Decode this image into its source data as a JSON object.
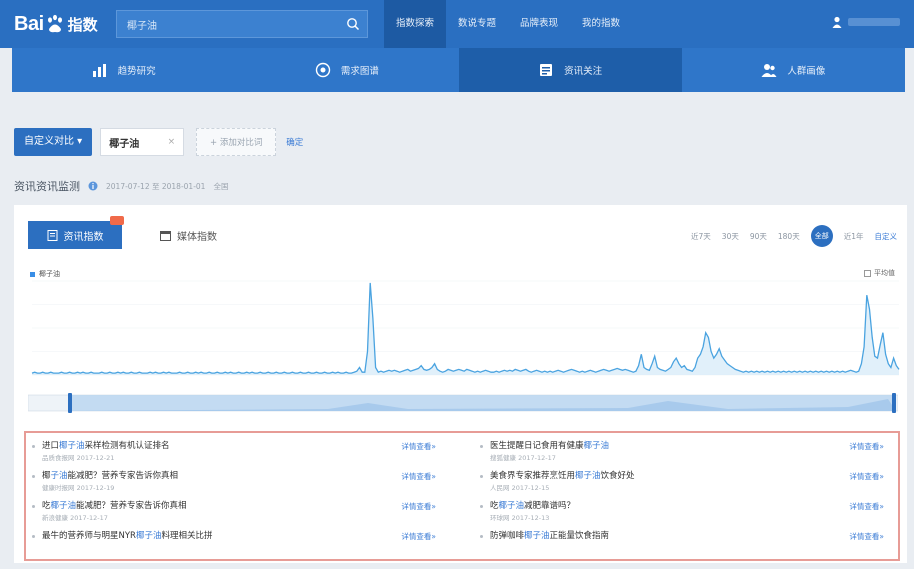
{
  "header": {
    "logo_brand": "Bai",
    "logo_suffix": "指数",
    "search_value": "椰子油",
    "nav": [
      "指数探索",
      "数说专题",
      "品牌表现",
      "我的指数"
    ],
    "active_nav": 0
  },
  "subnav": {
    "items": [
      "趋势研究",
      "需求图谱",
      "资讯关注",
      "人群画像"
    ],
    "icons": [
      "chart-bar-icon",
      "target-icon",
      "news-icon",
      "people-icon"
    ],
    "active": 2
  },
  "filter": {
    "type_button": "自定义对比",
    "keyword": "椰子油",
    "keyword_close": "×",
    "add_compare": "+ 添加对比词",
    "confirm": "确定"
  },
  "section": {
    "title": "资讯资讯监测",
    "meta": "2017-07-12 至 2018-01-01",
    "link": "全国"
  },
  "tabs": {
    "active_label": "资讯指数",
    "inactive_label": "媒体指数"
  },
  "ranges": [
    "近7天",
    "30天",
    "90天",
    "180天",
    "全部",
    "近1年",
    "自定义"
  ],
  "active_range": 4,
  "legend": {
    "series": "椰子油",
    "average": "平均值"
  },
  "chart_data": {
    "type": "area",
    "series": [
      {
        "name": "椰子油",
        "values": [
          2,
          3,
          2,
          2,
          3,
          2,
          2,
          3,
          2,
          2,
          2,
          3,
          2,
          2,
          3,
          2,
          2,
          3,
          2,
          3,
          2,
          2,
          3,
          2,
          2,
          2,
          3,
          2,
          2,
          3,
          2,
          2,
          3,
          2,
          3,
          2,
          2,
          3,
          2,
          2,
          3,
          2,
          2,
          2,
          3,
          2,
          3,
          2,
          2,
          3,
          2,
          3,
          2,
          2,
          2,
          3,
          2,
          2,
          3,
          2,
          2,
          3,
          2,
          3,
          2,
          2,
          3,
          2,
          2,
          3,
          2,
          2,
          3,
          2,
          3,
          2,
          2,
          3,
          2,
          2,
          3,
          2,
          3,
          2,
          2,
          3,
          2,
          2,
          3,
          2,
          2,
          3,
          2,
          2,
          3,
          2,
          2,
          3,
          2,
          2,
          3,
          2,
          2,
          3,
          2,
          2,
          3,
          2,
          2,
          3,
          2,
          2,
          3,
          2,
          3,
          2,
          2,
          3,
          2,
          2,
          3,
          4,
          8,
          3,
          3,
          25,
          98,
          60,
          8,
          3,
          4,
          3,
          4,
          5,
          4,
          5,
          4,
          3,
          4,
          5,
          6,
          4,
          5,
          6,
          7,
          10,
          6,
          5,
          6,
          8,
          12,
          6,
          4,
          3,
          4,
          6,
          5,
          4,
          5,
          6,
          5,
          4,
          6,
          5,
          4,
          3,
          4,
          3,
          4,
          5,
          4,
          3,
          3,
          4,
          3,
          4,
          5,
          4,
          5,
          4,
          6,
          5,
          4,
          5,
          6,
          4,
          3,
          4,
          5,
          4,
          3,
          4,
          3,
          4,
          3,
          4,
          5,
          4,
          3,
          4,
          5,
          6,
          5,
          4,
          3,
          4,
          3,
          4,
          5,
          4,
          3,
          4,
          5,
          6,
          5,
          4,
          5,
          6,
          7,
          6,
          5,
          6,
          5,
          4,
          3,
          4,
          10,
          22,
          8,
          6,
          5,
          12,
          20,
          8,
          6,
          5,
          4,
          6,
          8,
          14,
          18,
          12,
          8,
          10,
          6,
          5,
          4,
          8,
          18,
          22,
          30,
          45,
          40,
          25,
          18,
          22,
          28,
          20,
          16,
          12,
          10,
          8,
          6,
          5,
          4,
          3,
          4,
          3,
          4,
          3,
          4,
          3,
          4,
          3,
          4,
          3,
          4,
          3,
          4,
          3,
          4,
          3,
          4,
          3,
          4,
          3,
          4,
          3,
          4,
          3,
          4,
          3,
          4,
          3,
          4,
          3,
          4,
          3,
          4,
          3,
          4,
          3,
          4,
          3,
          4,
          5,
          4,
          3,
          4,
          12,
          30,
          85,
          70,
          40,
          20,
          18,
          32,
          45,
          22,
          12,
          8,
          18,
          10,
          6
        ]
      }
    ],
    "ylim": [
      0,
      100
    ],
    "xlabel": "",
    "ylabel": "",
    "grid": true
  },
  "news": {
    "left": [
      {
        "pre": "进口",
        "hl": "椰子油",
        "post": "采样检测有机认证排名",
        "meta": "品质食报网 2017-12-21",
        "more": "详情查看»"
      },
      {
        "pre": "椰",
        "hl": "子油",
        "post": "能减肥？营养专家告诉你真相",
        "meta": "健康时报网 2017-12-19",
        "more": "详情查看»"
      },
      {
        "pre": "吃",
        "hl": "椰子油",
        "post": "能减肥？营养专家告诉你真相",
        "meta": "新浪健康 2017-12-17",
        "more": "详情查看»"
      },
      {
        "pre": "最牛的营养师与明星NYR",
        "hl": "椰子油",
        "post": "料理相关比拼",
        "meta": "",
        "more": "详情查看»"
      }
    ],
    "right": [
      {
        "pre": "医生提醒日记食用有健康",
        "hl": "椰子油",
        "post": "",
        "meta": "搜狐健康 2017-12-17",
        "more": "详情查看»"
      },
      {
        "pre": "美食界专家推荐烹饪用",
        "hl": "椰子油",
        "post": "饮食好处",
        "meta": "人民网 2017-12-15",
        "more": "详情查看»"
      },
      {
        "pre": "吃",
        "hl": "椰子油",
        "post": "减肥靠谱吗？",
        "meta": "环球网 2017-12-13",
        "more": "详情查看»"
      },
      {
        "pre": "防弹咖啡",
        "hl": "椰子油",
        "post": "正能量饮食指南",
        "meta": "",
        "more": "详情查看»"
      }
    ]
  },
  "colors": {
    "primary": "#2c6fc0",
    "header": "#2a6fc1",
    "line": "#4aa3e0",
    "area": "#d4e9f8",
    "highlight_border": "#e79c96"
  }
}
